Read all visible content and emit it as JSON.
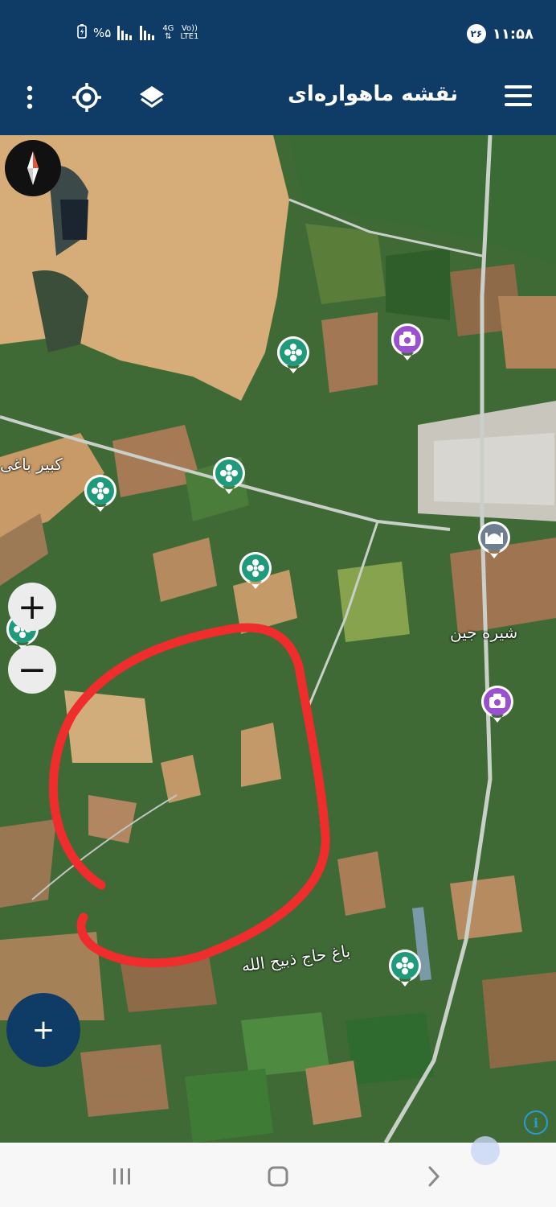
{
  "status_bar": {
    "time": "۱۱:۵۸",
    "notification_badge": "۲۶",
    "battery": "%۵",
    "network": "4G",
    "volte": "Vo))",
    "lte": "LTE1"
  },
  "app_bar": {
    "title": "نقشه ماهواره‌ای",
    "icons": [
      "menu-icon",
      "layers-icon",
      "my-location-icon",
      "more-vert-icon"
    ]
  },
  "map": {
    "labels": {
      "kabir_baghi": "کبیر باغی",
      "shireh_jin": "شیره جین",
      "bagh_haj": "باغ حاج ذبیح الله"
    },
    "markers": [
      "garden-marker",
      "garden-marker",
      "garden-marker",
      "garden-marker",
      "garden-marker",
      "garden-marker",
      "camera-marker",
      "camera-marker",
      "mosque-marker"
    ],
    "highlight_color": "#ef2d2d"
  },
  "controls": {
    "zoom_in": "+",
    "zoom_out": "−",
    "add": "+",
    "info": "i"
  },
  "colors": {
    "primary": "#0f3c66",
    "marker_green": "#1f9a7a",
    "marker_purple": "#9b4fd1"
  }
}
